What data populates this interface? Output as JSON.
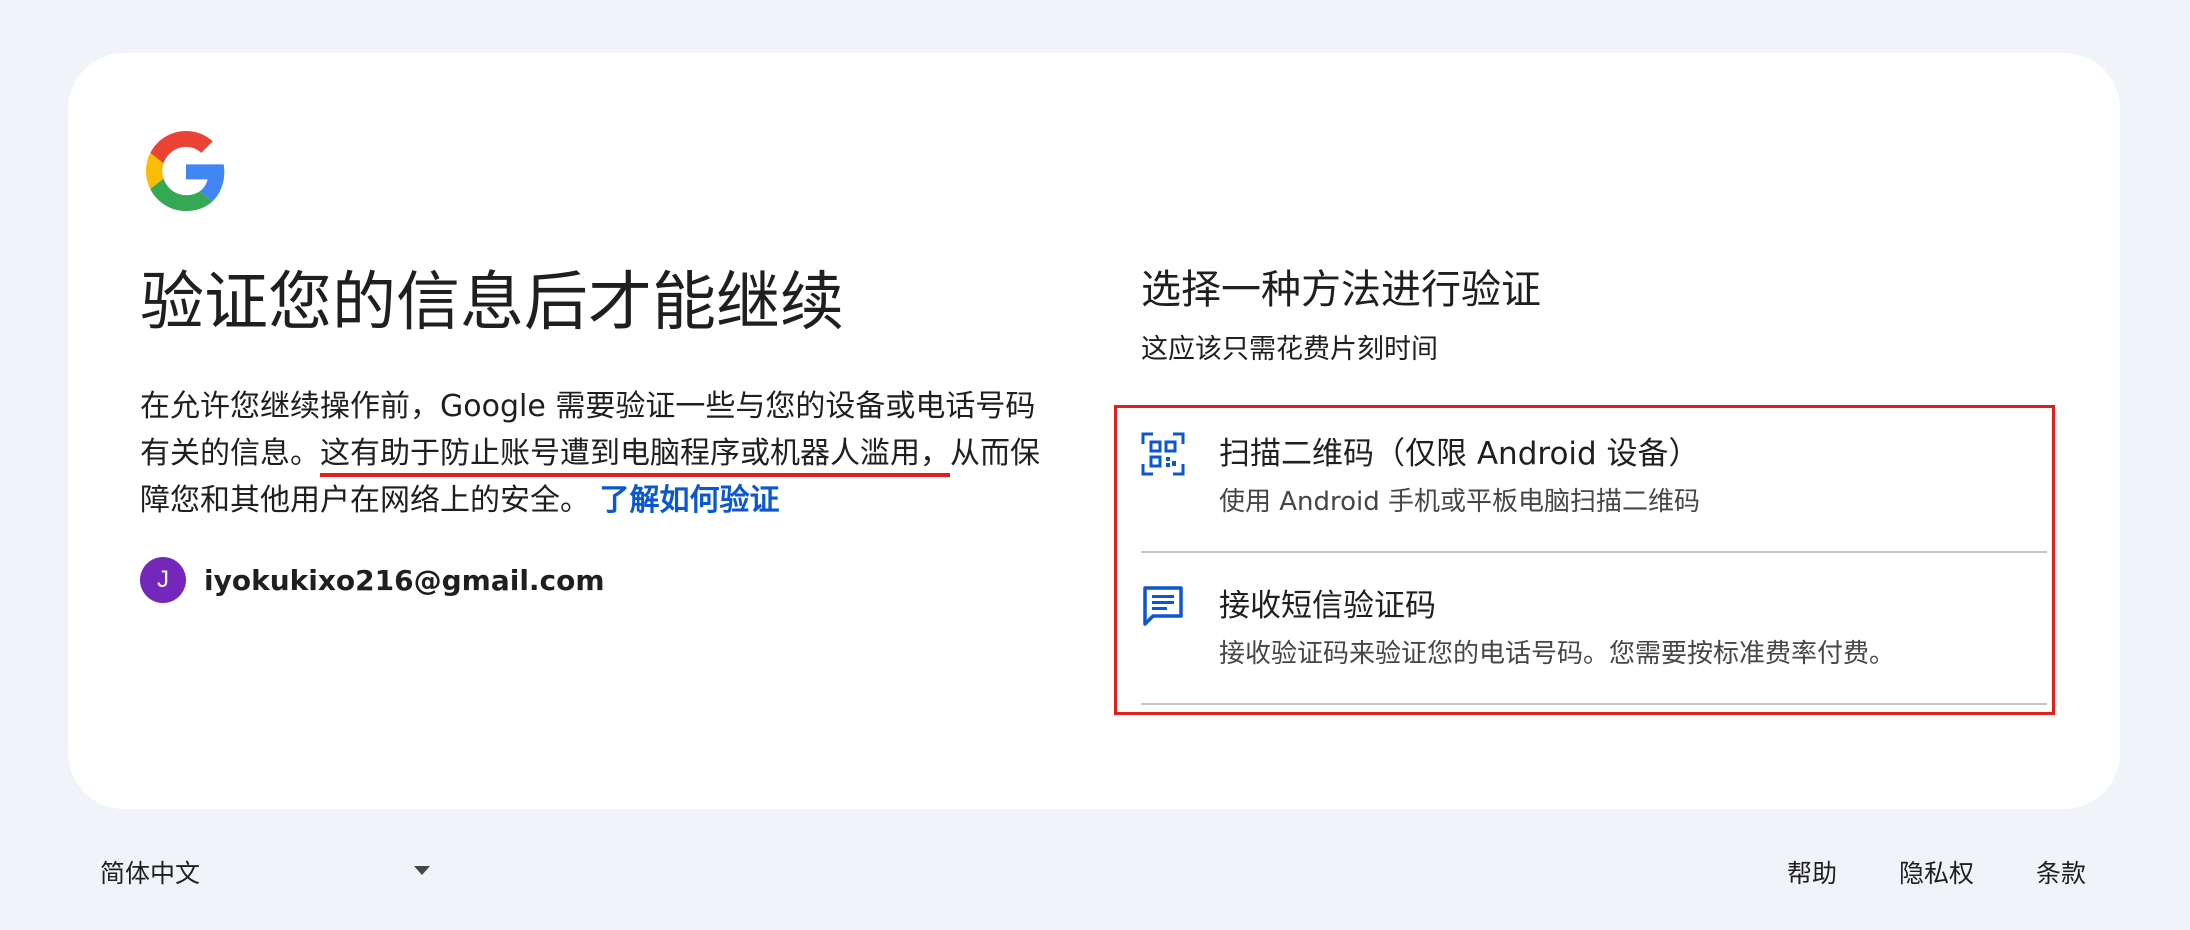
{
  "heading": {
    "title": "验证您的信息后才能继续"
  },
  "description": {
    "part1": "在允许您继续操作前，Google 需要验证一些与您的设备或电话号码有关的信息。",
    "part2_underlined": "这有助于防止账号遭到电脑程序或机器人滥用，",
    "part3": "从而保障您和其他用户在网络上的安全。",
    "learn_more_link": "了解如何验证"
  },
  "account": {
    "avatar_letter": "J",
    "avatar_color": "#7627bb",
    "email": "iyokukixo216@gmail.com"
  },
  "methods": {
    "title": "选择一种方法进行验证",
    "subtitle": "这应该只需花费片刻时间",
    "options": [
      {
        "icon": "qr-code-icon",
        "title": "扫描二维码（仅限 Android 设备）",
        "description": "使用 Android 手机或平板电脑扫描二维码"
      },
      {
        "icon": "message-icon",
        "title": "接收短信验证码",
        "description": "接收验证码来验证您的电话号码。您需要按标准费率付费。"
      }
    ]
  },
  "footer": {
    "language": "简体中文",
    "links": [
      "帮助",
      "隐私权",
      "条款"
    ]
  },
  "colors": {
    "link": "#0b57d0",
    "highlight": "#e0201c",
    "icon": "#0b57d0",
    "background": "#f0f4f9"
  }
}
